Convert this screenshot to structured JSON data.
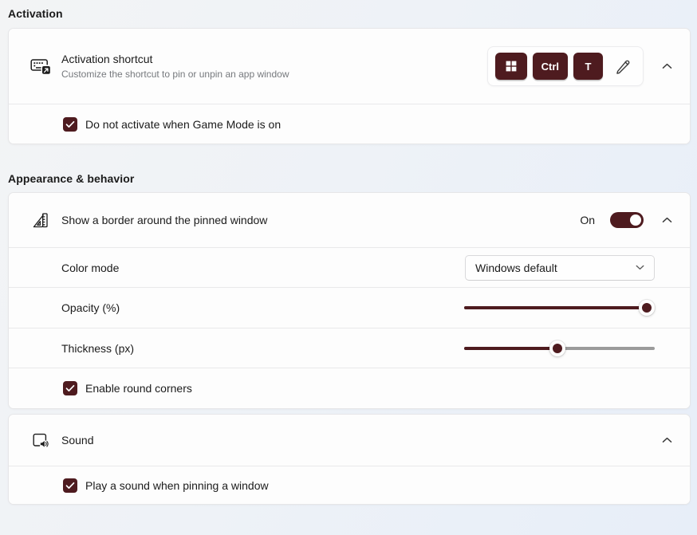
{
  "accent_color": "#4e1b1f",
  "icons": {
    "activation_row": "keyboard-shortcut-icon",
    "border_row": "ruler-border-icon",
    "sound_row": "monitor-sound-icon",
    "edit": "pencil-icon",
    "expander": "chevron-up-icon",
    "dropdown": "chevron-down-icon",
    "checkbox": "check-icon",
    "win_key": "windows-logo-icon"
  },
  "sections": {
    "activation": {
      "header": "Activation",
      "shortcut_row": {
        "title": "Activation shortcut",
        "description": "Customize the shortcut to pin or unpin an app window",
        "keys": [
          {
            "icon": "windows-logo-icon"
          },
          {
            "label": "Ctrl"
          },
          {
            "label": "T"
          }
        ]
      },
      "game_mode_row": {
        "label": "Do not activate when Game Mode is on",
        "checked": true
      }
    },
    "appearance": {
      "header": "Appearance & behavior",
      "border_row": {
        "label": "Show a border around the pinned window",
        "toggle_state": "On",
        "toggle_on": true
      },
      "color_mode_row": {
        "label": "Color mode",
        "selected_value": "Windows default"
      },
      "opacity_row": {
        "label": "Opacity (%)",
        "slider_percent": 100
      },
      "thickness_row": {
        "label": "Thickness (px)",
        "slider_percent": 49
      },
      "round_corners_row": {
        "label": "Enable round corners",
        "checked": true
      }
    },
    "sound": {
      "title": "Sound",
      "play_sound_row": {
        "label": "Play a sound when pinning a window",
        "checked": true
      }
    }
  }
}
